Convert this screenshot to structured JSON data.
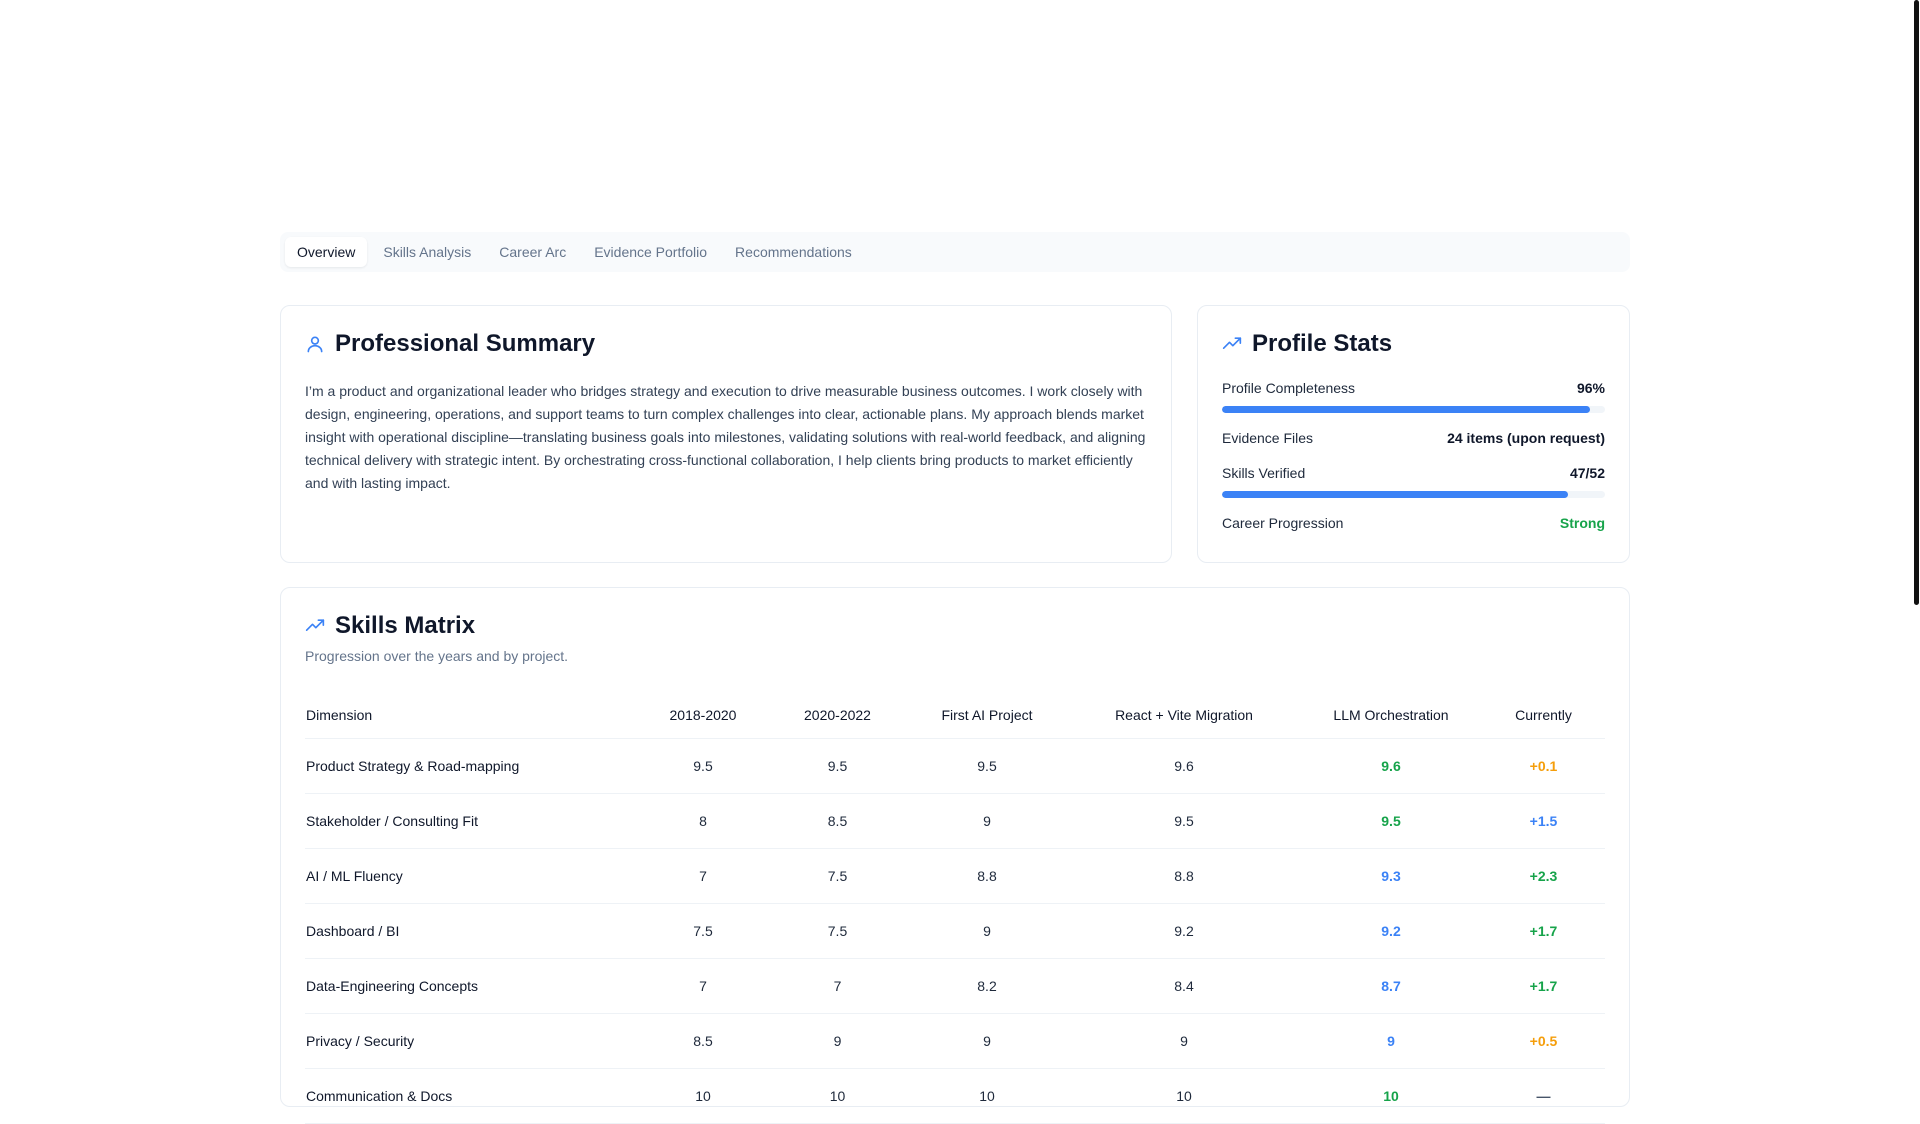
{
  "tabs": [
    {
      "label": "Overview",
      "active": true
    },
    {
      "label": "Skills Analysis",
      "active": false
    },
    {
      "label": "Career Arc",
      "active": false
    },
    {
      "label": "Evidence Portfolio",
      "active": false
    },
    {
      "label": "Recommendations",
      "active": false
    }
  ],
  "summary": {
    "title": "Professional Summary",
    "icon": "user-icon",
    "text": "I’m a product and organizational leader who bridges strategy and execution to drive measurable business outcomes. I work closely with design, engineering, operations, and support teams to turn complex challenges into clear, actionable plans. My approach blends market insight with operational discipline—translating business goals into milestones, validating solutions with real-world feedback, and aligning technical delivery with strategic intent. By orchestrating cross-functional collaboration, I help clients bring products to market efficiently and with lasting impact."
  },
  "stats": {
    "title": "Profile Stats",
    "icon": "trending-up-icon",
    "profile_completeness": {
      "label": "Profile Completeness",
      "value": "96%",
      "fraction": 0.96
    },
    "evidence_files": {
      "label": "Evidence Files",
      "value": "24 items (upon request)"
    },
    "skills_verified": {
      "label": "Skills Verified",
      "value": "47/52",
      "fraction": 0.9038
    },
    "career_progression": {
      "label": "Career Progression",
      "value": "Strong",
      "color": "#16a34a"
    }
  },
  "matrix": {
    "title": "Skills Matrix",
    "icon": "trending-up-icon",
    "subtitle": "Progression over the years and by project.",
    "columns": [
      "Dimension",
      "2018-2020",
      "2020-2022",
      "First AI Project",
      "React + Vite Migration",
      "LLM Orchestration",
      "Currently"
    ],
    "rows": [
      {
        "dimension": "Product Strategy & Road-mapping",
        "values": [
          "9.5",
          "9.5",
          "9.5",
          "9.6"
        ],
        "llm": "9.6",
        "llm_color": "green",
        "current": "+0.1",
        "current_color": "amber"
      },
      {
        "dimension": "Stakeholder / Consulting Fit",
        "values": [
          "8",
          "8.5",
          "9",
          "9.5"
        ],
        "llm": "9.5",
        "llm_color": "green",
        "current": "+1.5",
        "current_color": "blue"
      },
      {
        "dimension": "AI / ML Fluency",
        "values": [
          "7",
          "7.5",
          "8.8",
          "8.8"
        ],
        "llm": "9.3",
        "llm_color": "blue",
        "current": "+2.3",
        "current_color": "green"
      },
      {
        "dimension": "Dashboard / BI",
        "values": [
          "7.5",
          "7.5",
          "9",
          "9.2"
        ],
        "llm": "9.2",
        "llm_color": "blue",
        "current": "+1.7",
        "current_color": "green"
      },
      {
        "dimension": "Data-Engineering Concepts",
        "values": [
          "7",
          "7",
          "8.2",
          "8.4"
        ],
        "llm": "8.7",
        "llm_color": "blue",
        "current": "+1.7",
        "current_color": "green"
      },
      {
        "dimension": "Privacy / Security",
        "values": [
          "8.5",
          "9",
          "9",
          "9"
        ],
        "llm": "9",
        "llm_color": "blue",
        "current": "+0.5",
        "current_color": "amber"
      },
      {
        "dimension": "Communication & Docs",
        "values": [
          "10",
          "10",
          "10",
          "10"
        ],
        "llm": "10",
        "llm_color": "green",
        "current": "—",
        "current_color": "muted"
      }
    ]
  },
  "colors": {
    "accent": "#3b82f6",
    "green": "#16a34a",
    "amber": "#f59e0b"
  }
}
